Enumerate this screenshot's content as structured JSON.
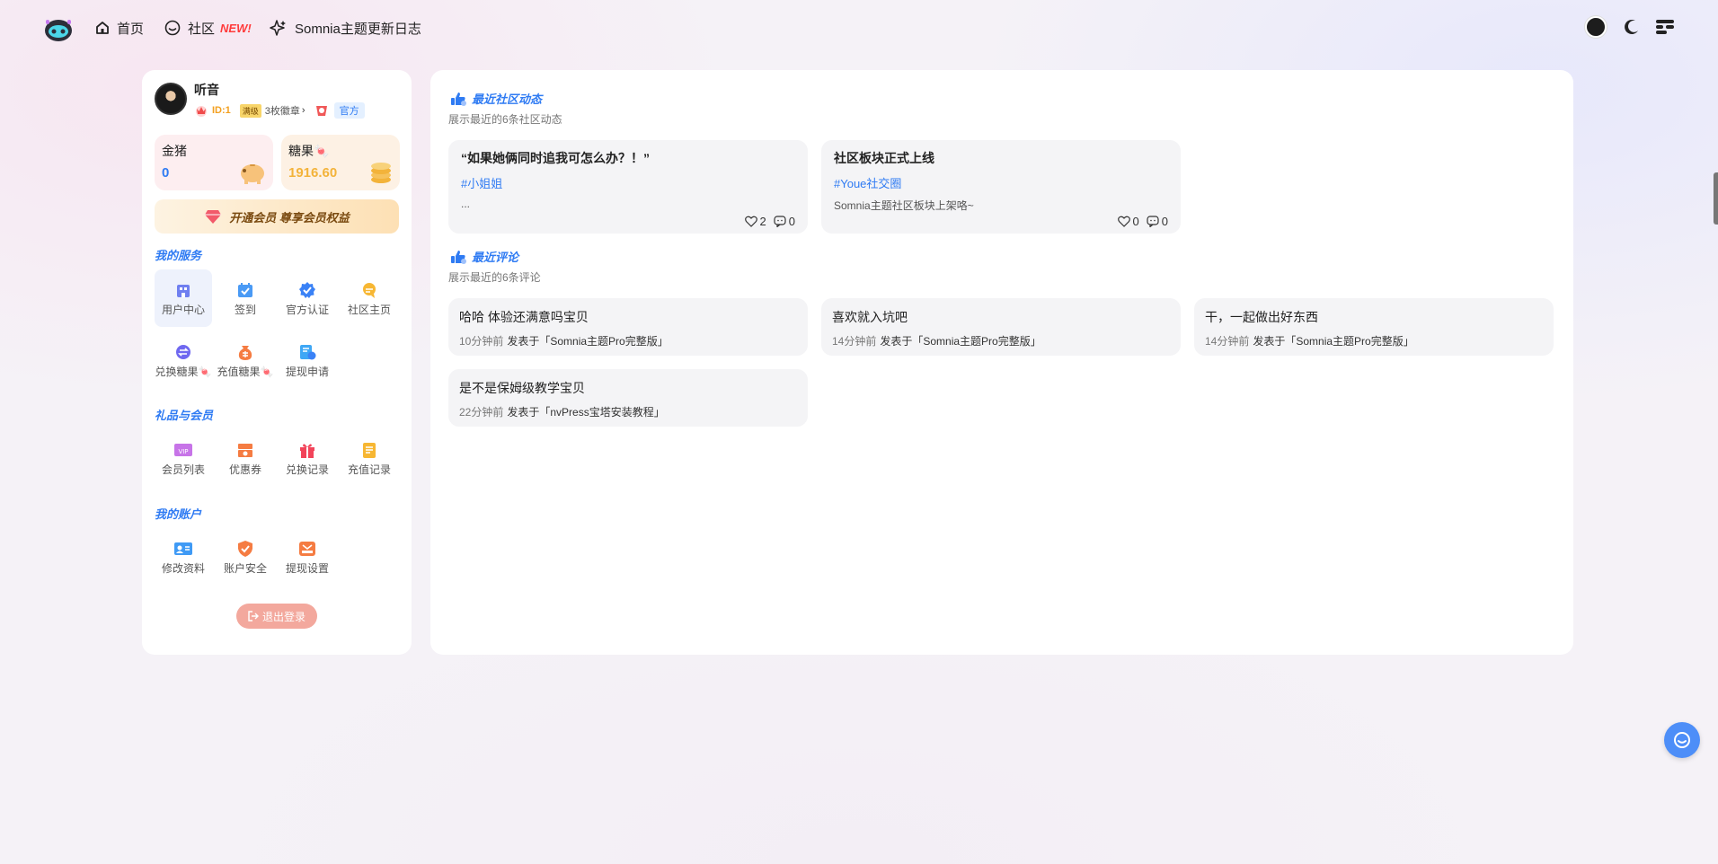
{
  "nav": {
    "home": "首页",
    "community": "社区",
    "community_badge": "NEW!",
    "changelog": "Somnia主题更新日志"
  },
  "user": {
    "name": "听音",
    "id": "ID:1",
    "badge": "满级",
    "badge_count": "3枚徽章",
    "official": "官方"
  },
  "wallet": {
    "gold_title": "金猪",
    "gold_value": "0",
    "candy_title": "糖果",
    "candy_value": "1916.60"
  },
  "vip_button": "开通会员 尊享会员权益",
  "sections": {
    "services": "我的服务",
    "gifts": "礼品与会员",
    "account": "我的账户"
  },
  "services": [
    {
      "label": "用户中心",
      "icon": "user-center-icon"
    },
    {
      "label": "签到",
      "icon": "checkin-icon"
    },
    {
      "label": "官方认证",
      "icon": "verify-icon"
    },
    {
      "label": "社区主页",
      "icon": "community-home-icon"
    },
    {
      "label": "兑换糖果🍬",
      "icon": "exchange-icon"
    },
    {
      "label": "充值糖果🍬",
      "icon": "recharge-icon"
    },
    {
      "label": "提现申请",
      "icon": "withdraw-icon"
    }
  ],
  "gifts": [
    {
      "label": "会员列表",
      "icon": "vip-list-icon"
    },
    {
      "label": "优惠券",
      "icon": "coupon-icon"
    },
    {
      "label": "兑换记录",
      "icon": "gift-icon"
    },
    {
      "label": "充值记录",
      "icon": "record-icon"
    }
  ],
  "account": [
    {
      "label": "修改资料",
      "icon": "profile-icon"
    },
    {
      "label": "账户安全",
      "icon": "shield-icon"
    },
    {
      "label": "提现设置",
      "icon": "withdraw-settings-icon"
    }
  ],
  "logout": "退出登录",
  "recent_posts": {
    "title": "最近社区动态",
    "subtitle": "展示最近的6条社区动态",
    "items": [
      {
        "title": "“如果她俩同时追我可怎么办？！”",
        "tag": "#小姐姐",
        "excerpt": "...",
        "likes": "2",
        "comments": "0"
      },
      {
        "title": "社区板块正式上线",
        "tag": "#Youe社交圈",
        "excerpt": "Somnia主题社区板块上架咯~",
        "likes": "0",
        "comments": "0"
      }
    ]
  },
  "recent_comments": {
    "title": "最近评论",
    "subtitle": "展示最近的6条评论",
    "items": [
      {
        "text": "哈哈 体验还满意吗宝贝",
        "time": "10分钟前",
        "on": "发表于「Somnia主题Pro完整版」"
      },
      {
        "text": "喜欢就入坑吧",
        "time": "14分钟前",
        "on": "发表于「Somnia主题Pro完整版」"
      },
      {
        "text": "干，一起做出好东西",
        "time": "14分钟前",
        "on": "发表于「Somnia主题Pro完整版」"
      },
      {
        "text": "是不是保姆级教学宝贝",
        "time": "22分钟前",
        "on": "发表于「nvPress宝塔安装教程」"
      }
    ]
  },
  "colors": {
    "accent": "#2f7bf3",
    "candy": "#f3b33a",
    "logout": "#f3a89d"
  }
}
